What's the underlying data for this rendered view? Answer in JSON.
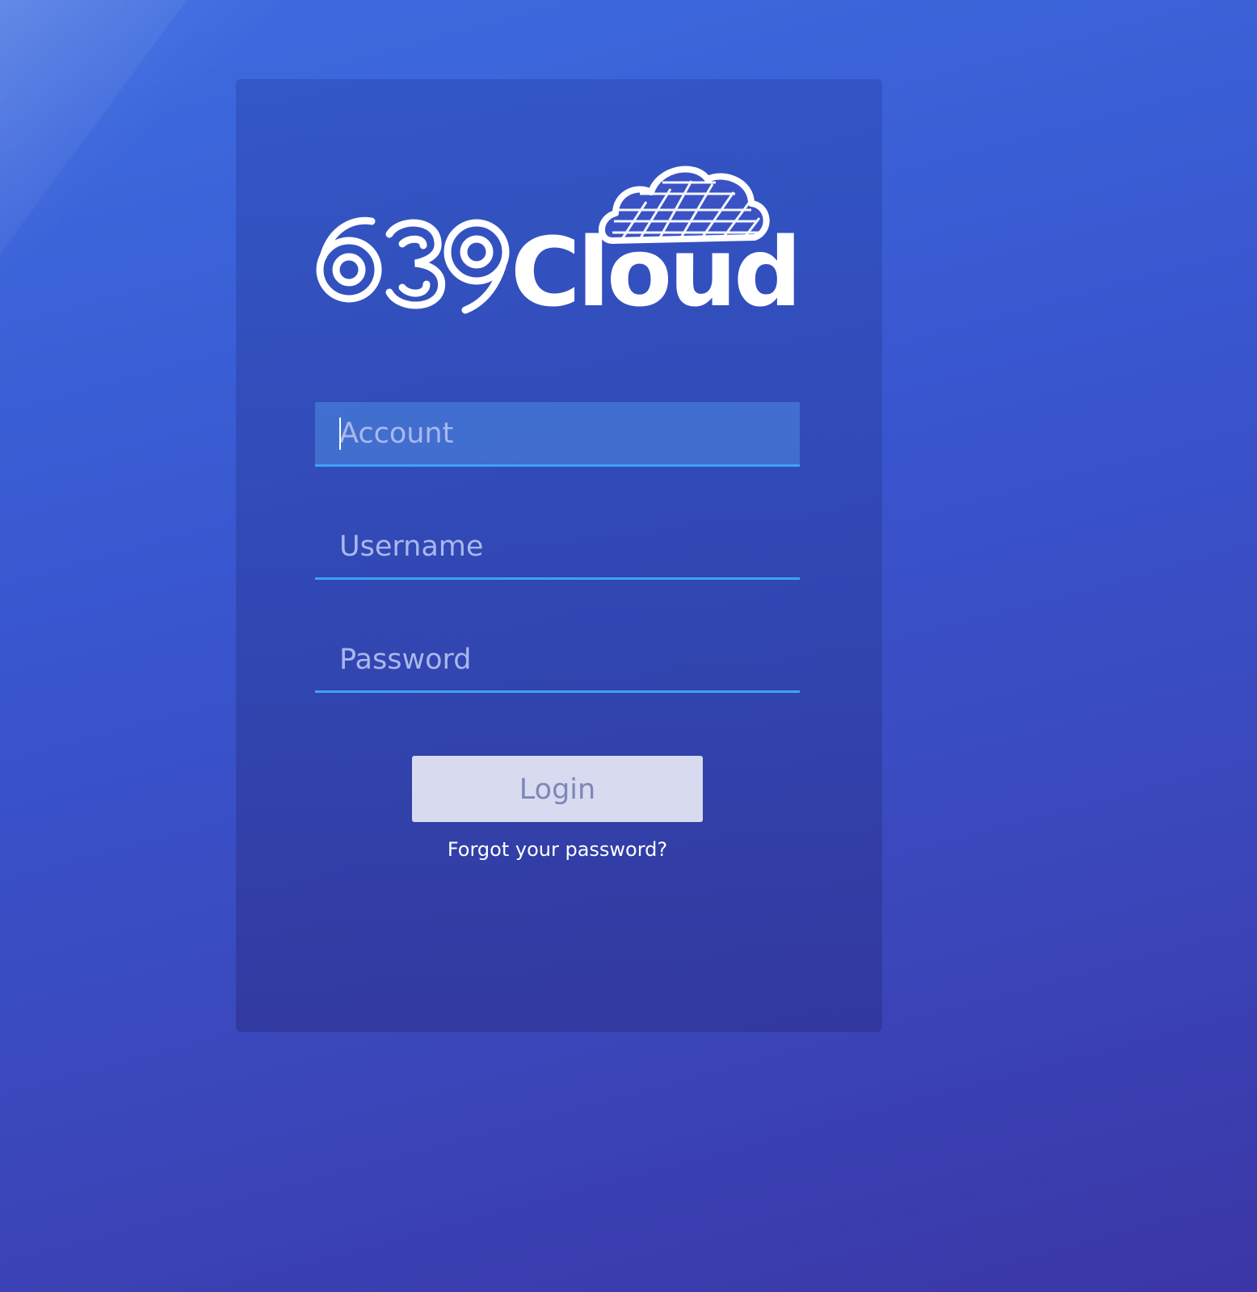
{
  "brand": {
    "logo_text": "639Cloud",
    "logo_icon": "cloud-grid-icon"
  },
  "form": {
    "account_placeholder": "Account",
    "username_placeholder": "Username",
    "password_placeholder": "Password",
    "login_label": "Login",
    "forgot_label": "Forgot your password?"
  },
  "colors": {
    "background_top": "#3d6de0",
    "background_bottom": "#3b36a6",
    "field_underline": "#3ea3f2",
    "button_bg": "#d8dbef",
    "button_text": "#7d87b8"
  }
}
